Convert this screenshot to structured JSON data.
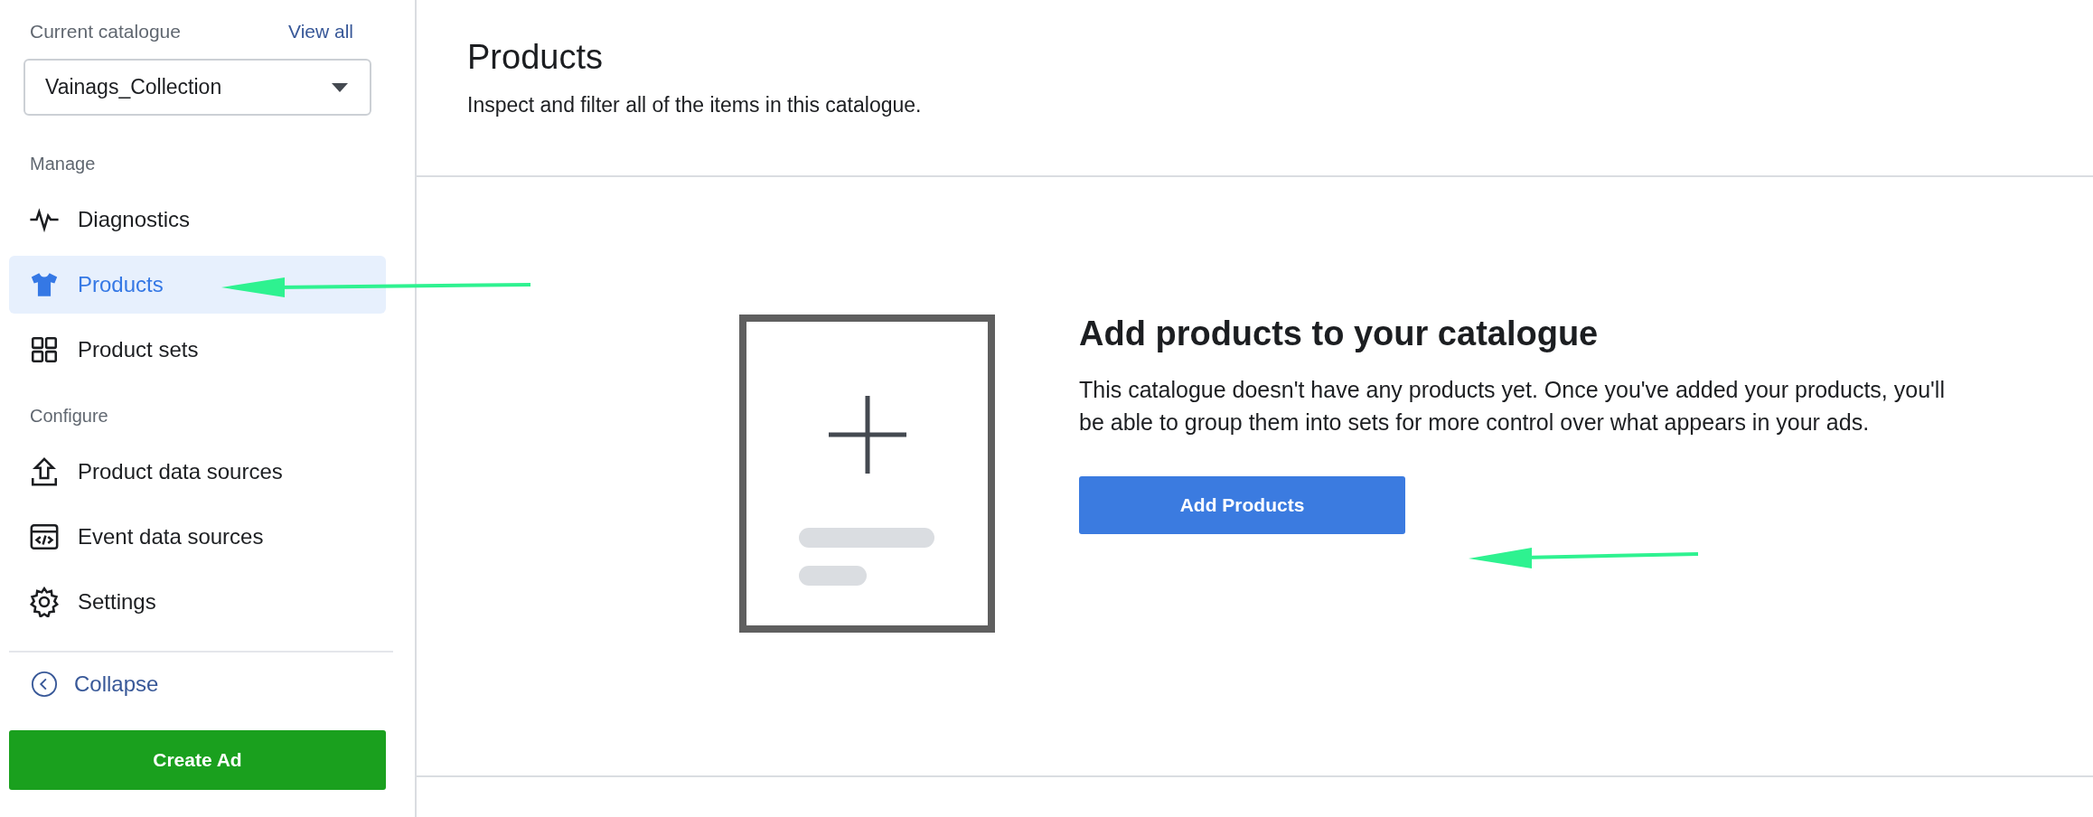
{
  "sidebar": {
    "catalogue_label": "Current catalogue",
    "view_all": "View all",
    "catalogue": "Vainags_Collection",
    "sections": [
      {
        "title": "Manage",
        "items": [
          {
            "label": "Diagnostics",
            "selected": false
          },
          {
            "label": "Products",
            "selected": true
          },
          {
            "label": "Product sets",
            "selected": false
          }
        ]
      },
      {
        "title": "Configure",
        "items": [
          {
            "label": "Product data sources",
            "selected": false
          },
          {
            "label": "Event data sources",
            "selected": false
          },
          {
            "label": "Settings",
            "selected": false
          }
        ]
      }
    ],
    "collapse": "Collapse",
    "create_ad": "Create Ad"
  },
  "header": {
    "title": "Products",
    "subtitle": "Inspect and filter all of the items in this catalogue."
  },
  "empty_state": {
    "heading": "Add products to your catalogue",
    "text": "This catalogue doesn't have any products yet. Once you've added your products, you'll be able to group them into sets for more control over what appears in your ads.",
    "button": "Add Products"
  }
}
